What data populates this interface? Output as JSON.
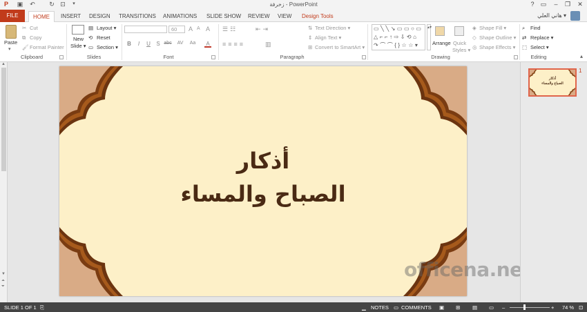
{
  "titlebar": {
    "title": "زخرفة - PowerPoint",
    "help": "?",
    "minimize": "–",
    "restore": "❐",
    "close": "✕"
  },
  "tabs": {
    "file": "FILE",
    "home": "HOME",
    "insert": "INSERT",
    "design": "DESIGN",
    "transitions": "TRANSITIONS",
    "animations": "ANIMATIONS",
    "slide_show": "SLIDE SHOW",
    "review": "REVIEW",
    "view": "VIEW",
    "design_tools": "Design Tools",
    "user": "هاني العلي ▾"
  },
  "ribbon": {
    "clipboard": {
      "paste": "Paste",
      "cut": "Cut",
      "copy": "Copy",
      "format_painter": "Format Painter",
      "label": "Clipboard"
    },
    "slides": {
      "new_slide": "New",
      "new_slide2": "Slide ▾",
      "layout": "Layout ▾",
      "reset": "Reset",
      "section": "Section ▾",
      "label": "Slides"
    },
    "font": {
      "size": "60",
      "bold": "B",
      "italic": "I",
      "underline": "U",
      "strike": "S",
      "shadow": "abc",
      "spacing": "AV",
      "case": "Aa",
      "color": "A",
      "grow": "A",
      "shrink": "A",
      "clear": "A",
      "label": "Font"
    },
    "paragraph": {
      "text_direction": "Text Direction ▾",
      "align_text": "Align Text ▾",
      "smartart": "Convert to SmartArt ▾",
      "label": "Paragraph"
    },
    "drawing": {
      "arrange": "Arrange",
      "quick": "Quick",
      "styles": "Styles ▾",
      "shape_fill": "Shape Fill ▾",
      "shape_outline": "Shape Outline ▾",
      "shape_effects": "Shape Effects ▾",
      "label": "Drawing"
    },
    "editing": {
      "find": "Find",
      "replace": "Replace ▾",
      "select": "Select ▾",
      "label": "Editing"
    }
  },
  "slide": {
    "title": "أذكار",
    "subtitle": "الصباح والمساء"
  },
  "thumbnail": {
    "number": "1",
    "title": "أذكار",
    "subtitle": "الصباح والمساء"
  },
  "watermark": "officena.net",
  "status": {
    "slide_count": "SLIDE 1 OF 1",
    "notes": "NOTES",
    "comments": "COMMENTS",
    "zoom": "74 %",
    "zoom_level": 0.74
  },
  "colors": {
    "accent": "#c13b1b",
    "slide_bg": "#fdf0c8",
    "text": "#4a2a14",
    "corner_dark": "#8a4a14",
    "corner_light": "#d9ab86"
  }
}
